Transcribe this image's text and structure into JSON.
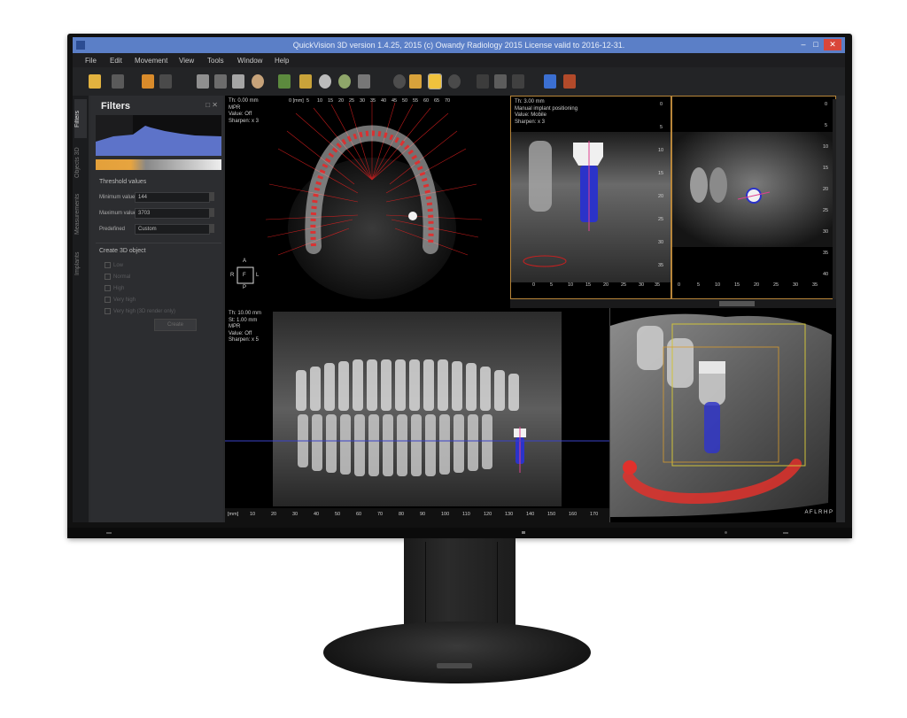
{
  "window": {
    "title": "QuickVision 3D version 1.4.25, 2015 (c) Owandy Radiology 2015 License valid to 2016-12-31.",
    "min": "–",
    "max": "□",
    "close": "✕"
  },
  "menu": [
    "File",
    "Edit",
    "Movement",
    "View",
    "Tools",
    "Window",
    "Help"
  ],
  "side_tabs": [
    "Filters",
    "Objects 3D",
    "Measurements",
    "Implants"
  ],
  "filters": {
    "title": "Filters",
    "close": "□ ✕",
    "threshold_header": "Threshold values",
    "min_label": "Minimum value",
    "min_value": "144",
    "max_label": "Maximum value",
    "max_value": "3703",
    "predefined_label": "Predefined",
    "predefined_value": "Custom",
    "create_header": "Create 3D object",
    "checks": [
      "Low",
      "Normal",
      "High",
      "Very high",
      "Very high (3D render only)"
    ],
    "create_button": "Create"
  },
  "views": {
    "axial": {
      "overlay": "Th: 0.00 mm\nMPR\nValue: Off\nSharpen: x 3",
      "ruler_unit": "0 [mm]",
      "ruler_ticks": [
        "5",
        "10",
        "15",
        "20",
        "25",
        "30",
        "35",
        "40",
        "45",
        "50",
        "55",
        "60",
        "65",
        "70"
      ],
      "orient": {
        "a": "A",
        "p": "P",
        "r": "R",
        "l": "L",
        "box": "F"
      }
    },
    "implant_long": {
      "overlay": "Th: 3.00 mm\nManual implant positioning\nValue: Mobile\nSharpen: x 3",
      "x_ticks": [
        "0",
        "5",
        "10",
        "15",
        "20",
        "25",
        "30",
        "35"
      ],
      "y_ticks": [
        "0",
        "5",
        "10",
        "15",
        "20",
        "25",
        "30",
        "35"
      ]
    },
    "implant_cross": {
      "x_ticks": [
        "0",
        "5",
        "10",
        "15",
        "20",
        "25",
        "30",
        "35"
      ],
      "y_ticks": [
        "0",
        "5",
        "10",
        "15",
        "20",
        "25",
        "30",
        "35",
        "40"
      ]
    },
    "panoramic": {
      "overlay": "Th: 10.00 mm\nSt: 1.00 mm\nMPR\nValue: Off\nSharpen: x 5",
      "ruler_unit": "[mm]",
      "ruler_ticks": [
        "10",
        "20",
        "30",
        "40",
        "50",
        "60",
        "70",
        "80",
        "90",
        "100",
        "110",
        "120",
        "130",
        "140",
        "150",
        "160",
        "170"
      ]
    },
    "render3d": {
      "orient": "A F L R H P"
    }
  },
  "colors": {
    "titlebar": "#5b7fc7",
    "implant_blue": "#2b33c9",
    "nerve_red": "#e0312c",
    "accent_orange": "#e3a03a"
  }
}
